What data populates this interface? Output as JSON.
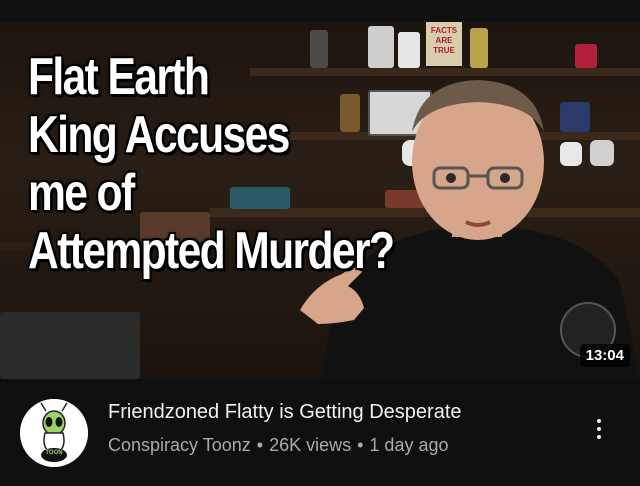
{
  "video": {
    "thumbnail_text": [
      "Flat Earth",
      "King Accuses",
      "me of",
      "Attempted Murder?"
    ],
    "prop_sign_text": [
      "FACTS",
      "ARE",
      "TRUE"
    ],
    "duration": "13:04",
    "title": "Friendzoned Flatty is Getting Desperate",
    "channel": "Conspiracy Toonz",
    "views": "26K views",
    "age": "1 day ago",
    "separator": "•"
  },
  "avatar": {
    "text": "TOON"
  },
  "icons": {
    "more": "more-vertical-icon",
    "avatar": "alien-mascot-icon",
    "badge": "channel-logo-icon"
  },
  "colors": {
    "background": "#0f0f0f",
    "title": "#f1f1f1",
    "meta": "#aaaaaa"
  }
}
